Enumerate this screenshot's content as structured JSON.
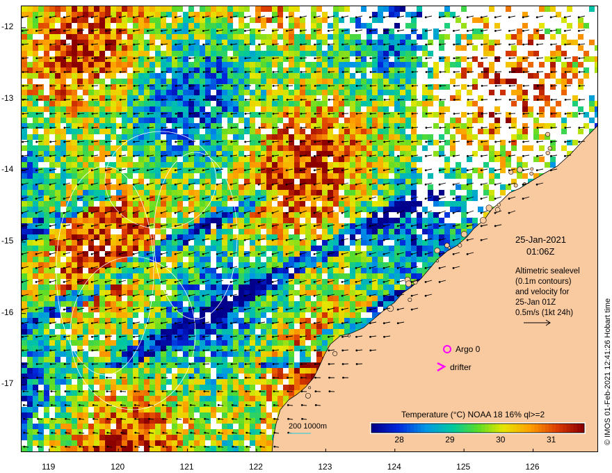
{
  "map": {
    "lon_ticks": [
      "119",
      "120",
      "121",
      "122",
      "123",
      "124",
      "125",
      "126"
    ],
    "lat_ticks": [
      "-12",
      "-13",
      "-14",
      "-15",
      "-16",
      "-17"
    ],
    "lon_range": [
      118.6,
      126.95
    ],
    "lat_range": [
      -17.95,
      -11.7
    ]
  },
  "info": {
    "date": "25-Jan-2021",
    "time": "01:06Z",
    "altimetry_lines": [
      "Altimetric sealevel",
      "(0.1m contours)",
      "and velocity for",
      "25-Jan 01Z",
      "0.5m/s (1kt 24h)"
    ]
  },
  "markers": {
    "argo_label": "Argo 0",
    "drifter_label": "drifter",
    "marker_color": "#ff00ff"
  },
  "colorbar": {
    "title": "Temperature (°C) NOAA 18 16% ql>=2",
    "ticks": [
      "28",
      "29",
      "30",
      "31"
    ],
    "tick_values": [
      28,
      29,
      30,
      31
    ],
    "min": 27.45,
    "max": 31.65
  },
  "depth_legend": {
    "label": "200 1000m"
  },
  "credit": "© IMOS 01-Feb-2021 12:41:26 Hobart time",
  "colors": {
    "land": "#f9c9a0",
    "coast": "#000000",
    "bathymetry": "#66cccc",
    "contour": "#ffffff",
    "vector": "#000000"
  }
}
